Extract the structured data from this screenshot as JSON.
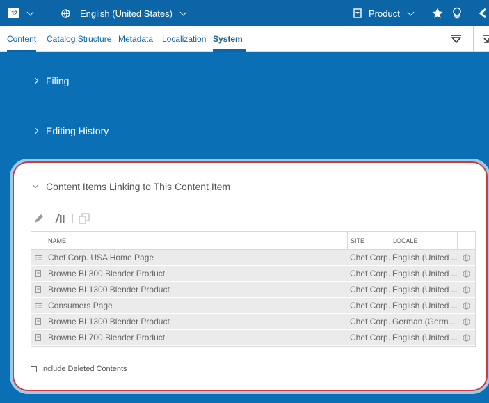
{
  "topbar": {
    "workspace_icon": "workspace-grid-icon",
    "language_label": "English (United States)",
    "product_label": "Product"
  },
  "tabs": [
    {
      "label": "Content"
    },
    {
      "label": "Catalog Structure"
    },
    {
      "label": "Metadata"
    },
    {
      "label": "Localization"
    },
    {
      "label": "System"
    }
  ],
  "sections": {
    "filing": "Filing",
    "editing_history": "Editing History"
  },
  "panel": {
    "title": "Content Items Linking to This Content Item",
    "columns": {
      "name": "NAME",
      "site": "SITE",
      "locale": "LOCALE"
    },
    "rows": [
      {
        "icon": "page-icon",
        "name": "Chef Corp. USA Home Page",
        "site": "Chef Corp.",
        "locale": "English (United ..."
      },
      {
        "icon": "product-icon",
        "name": "Browne BL300 Blender Product",
        "site": "Chef Corp.",
        "locale": "English (United ..."
      },
      {
        "icon": "product-icon",
        "name": "Browne BL1300 Blender Product",
        "site": "Chef Corp.",
        "locale": "English (United ..."
      },
      {
        "icon": "page-icon",
        "name": "Consumers Page",
        "site": "Chef Corp.",
        "locale": "English (United ..."
      },
      {
        "icon": "product-icon",
        "name": "Browne BL1300 Blender Product",
        "site": "Chef Corp.",
        "locale": "German (Germ..."
      },
      {
        "icon": "product-icon",
        "name": "Browne BL700 Blender Product",
        "site": "Chef Corp.",
        "locale": "English (United ..."
      }
    ],
    "include_deleted_label": "Include Deleted Contents"
  },
  "colors": {
    "accent": "#0b65a6",
    "background": "#0a6fb4",
    "highlight_border": "#d23a3a"
  }
}
